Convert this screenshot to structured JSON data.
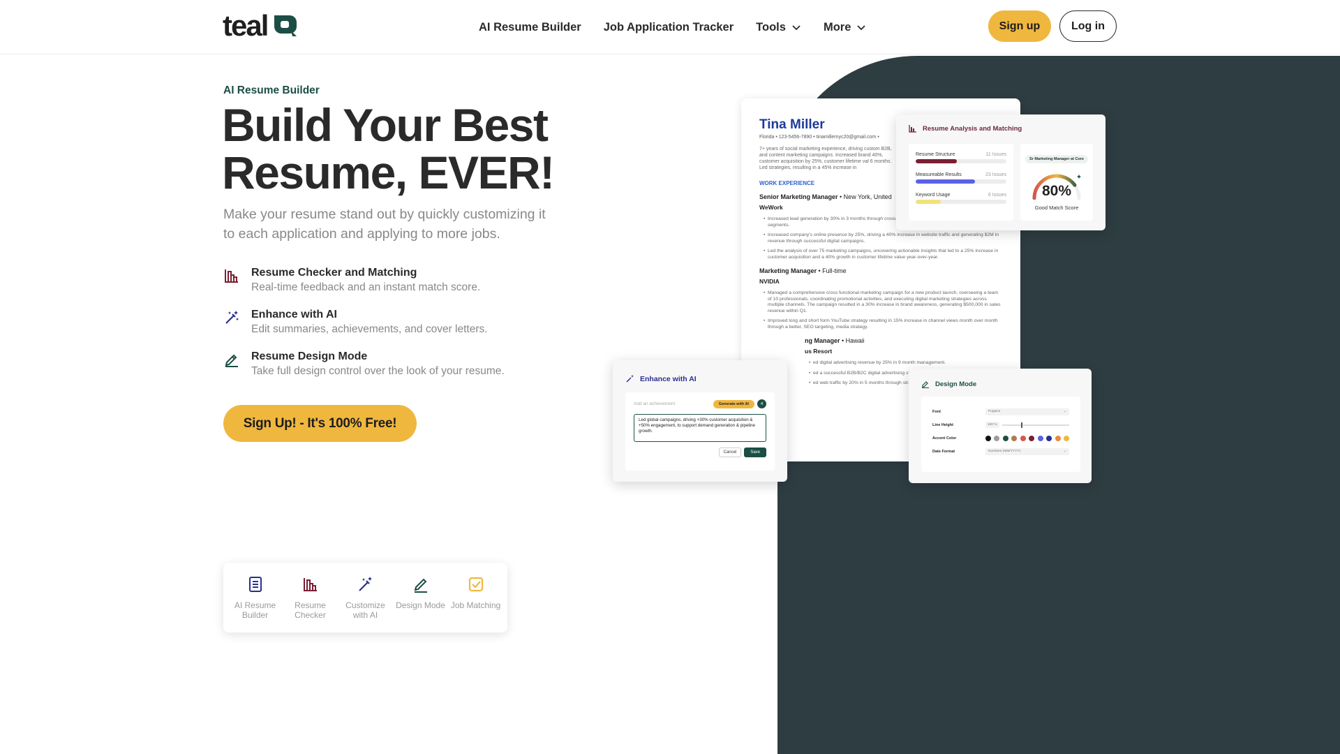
{
  "header": {
    "logo_text": "teal",
    "nav": [
      {
        "label": "AI Resume Builder"
      },
      {
        "label": "Job Application Tracker"
      },
      {
        "label": "Tools"
      },
      {
        "label": "More"
      }
    ],
    "signup_label": "Sign up",
    "login_label": "Log in"
  },
  "hero": {
    "eyebrow": "AI Resume Builder",
    "title_line1": "Build Your Best",
    "title_line2": "Resume, EVER!",
    "subtitle": "Make your resume stand out by quickly customizing it to each application and applying to more jobs.",
    "features": [
      {
        "title": "Resume Checker and Matching",
        "desc": "Real-time feedback and an instant match score."
      },
      {
        "title": "Enhance with AI",
        "desc": "Edit summaries, achievements, and cover letters."
      },
      {
        "title": "Resume Design Mode",
        "desc": "Take full design control over the look of your resume."
      }
    ],
    "cta_label": "Sign Up! - It's 100% Free!"
  },
  "tabs": [
    {
      "label": "AI Resume Builder"
    },
    {
      "label": "Resume Checker"
    },
    {
      "label": "Customize with AI"
    },
    {
      "label": "Design Mode"
    },
    {
      "label": "Job Matching"
    }
  ],
  "resume": {
    "name": "Tina Miller",
    "contact": "Florida • 123-5456-7890 • tinamillernyc20@gmail.com •",
    "summary": "7+ years of social marketing experience, driving custom B2B, and content marketing campaigns. Increased brand 40%, customer acquisition by 25%, customer lifetime val 6 months. Led strategies, resulting in a 45% increase in",
    "section_title": "WORK EXPERIENCE",
    "jobs": [
      {
        "role": "Senior Marketing Manager",
        "meta": " • New York, United",
        "company": "WeWork",
        "bullets": [
          "Increased lead generation by 30% in 3 months through cross-channel campaigns targeting key customer segments.",
          "Increased company's online presence by 25%, driving a 40% increase in website traffic and generating $2M in revenue through successful digital campaigns.",
          "Led the analysis of over 75 marketing campaigns, uncovering actionable insights that led to a 25% increase in customer acquisition and a 40% growth in customer lifetime value year-over-year."
        ]
      },
      {
        "role": "Marketing Manager",
        "meta": " • Full-time",
        "company": "NVIDIA",
        "bullets": [
          "Managed a comprehensive cross functional marketing campaign for a new product launch, overseeing a team of 10 professionals, coordinating promotional activities, and executing digital marketing strategies across multiple channels. The campaign resulted in a 30% increase in brand awareness, generating $500,000 in sales revenue within Q1.",
          "Improved long and short form YouTube strategy resulting in 15% increase in channel views month over month through a better, SEO targeting, media strategy."
        ]
      },
      {
        "role": "ng Manager",
        "meta": " • Hawaii",
        "company": "us Resort",
        "bullets": [
          "ed digital advertising revenue by 25% in 9 month management.",
          "ed a successful B2B/B2C digital advertising stra in 6 months.",
          "ed web traffic by 20% in 5 months through strate"
        ]
      }
    ]
  },
  "analysis": {
    "title": "Resume Analysis and Matching",
    "metrics": [
      {
        "label": "Resume Structure",
        "issues": "11 Issues",
        "fill": 0.45,
        "color": "#7a1f33"
      },
      {
        "label": "Measureable Results",
        "issues": "23 Issues",
        "fill": 0.65,
        "color": "#5b61e6"
      },
      {
        "label": "Keyword Usage",
        "issues": "6 Issues",
        "fill": 0.28,
        "color": "#f2e27a"
      }
    ],
    "chip": "Sr Marketing Manager at Core",
    "score": "80%",
    "score_value": 0.8,
    "score_label": "Good Match Score"
  },
  "enhance": {
    "title": "Enhance with AI",
    "placeholder": "Add an achievement",
    "generate_label": "Generate with AI",
    "count": "4",
    "text": "Led global campaigns, driving +30% customer acquisition & +50% engagement, to support demand generation & pipeline growth.",
    "cancel_label": "Cancel",
    "save_label": "Save"
  },
  "design": {
    "title": "Design Mode",
    "font_label": "Font",
    "font_value": "Poppins",
    "line_height_label": "Line Height",
    "line_height_value": "180 %",
    "line_height_level": 0.28,
    "accent_label": "Accent Color",
    "accent_colors": [
      "#111111",
      "#9c9c9c",
      "#1c4e45",
      "#b07a4f",
      "#d4574b",
      "#7a1f33",
      "#5b61e6",
      "#22318f",
      "#e88a3c",
      "#f0b73f"
    ],
    "date_label": "Date Format",
    "date_value": "Numbers (MM/YYYY)"
  },
  "colors": {
    "brand_dark": "#1c4e45",
    "accent_yellow": "#f0b73f",
    "panel_dark": "#2e3d42"
  }
}
